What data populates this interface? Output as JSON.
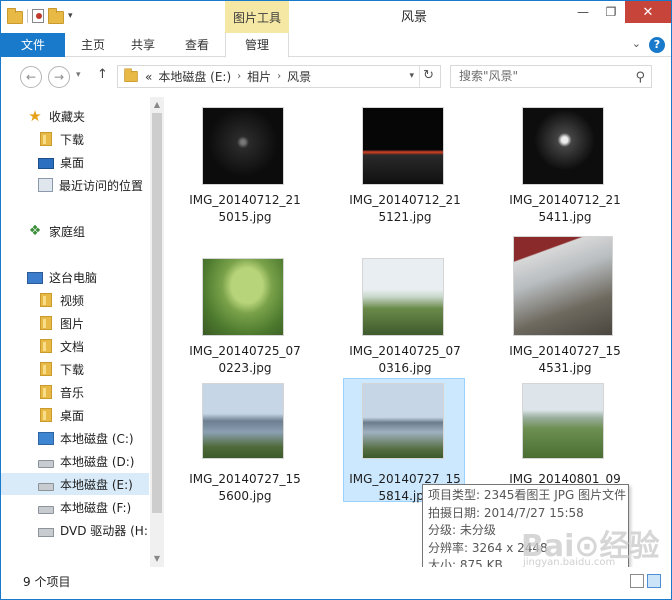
{
  "window": {
    "title": "风景",
    "context_tab_header": "图片工具"
  },
  "ribbon": {
    "tabs": [
      {
        "label": "文件"
      },
      {
        "label": "主页"
      },
      {
        "label": "共享"
      },
      {
        "label": "查看"
      },
      {
        "label": "管理"
      }
    ]
  },
  "address": {
    "prefix": "«",
    "crumbs": [
      "本地磁盘 (E:)",
      "相片",
      "风景"
    ]
  },
  "search": {
    "placeholder": "搜索\"风景\""
  },
  "sidebar": {
    "items": [
      {
        "label": "收藏夹",
        "icon": "star-icon"
      },
      {
        "label": "下载",
        "icon": "downloads-folder-icon"
      },
      {
        "label": "桌面",
        "icon": "desktop-icon"
      },
      {
        "label": "最近访问的位置",
        "icon": "recent-places-icon"
      },
      {
        "label": "家庭组",
        "icon": "homegroup-icon"
      },
      {
        "label": "这台电脑",
        "icon": "computer-icon"
      },
      {
        "label": "视频",
        "icon": "videos-folder-icon"
      },
      {
        "label": "图片",
        "icon": "pictures-folder-icon"
      },
      {
        "label": "文档",
        "icon": "documents-folder-icon"
      },
      {
        "label": "下载",
        "icon": "downloads-folder-icon"
      },
      {
        "label": "音乐",
        "icon": "music-folder-icon"
      },
      {
        "label": "桌面",
        "icon": "desktop-folder-icon"
      },
      {
        "label": "本地磁盘 (C:)",
        "icon": "system-drive-icon"
      },
      {
        "label": "本地磁盘 (D:)",
        "icon": "drive-icon"
      },
      {
        "label": "本地磁盘 (E:)",
        "icon": "drive-icon"
      },
      {
        "label": "本地磁盘 (F:)",
        "icon": "drive-icon"
      },
      {
        "label": "DVD 驱动器 (H:)",
        "icon": "dvd-drive-icon"
      }
    ]
  },
  "files": [
    {
      "name": "IMG_20140712_215015.jpg"
    },
    {
      "name": "IMG_20140712_215121.jpg"
    },
    {
      "name": "IMG_20140712_215411.jpg"
    },
    {
      "name": "IMG_20140725_070223.jpg"
    },
    {
      "name": "IMG_20140725_070316.jpg"
    },
    {
      "name": "IMG_20140727_154531.jpg"
    },
    {
      "name": "IMG_20140727_155600.jpg"
    },
    {
      "name": "IMG_20140727_155814.jpg"
    },
    {
      "name": "IMG_20140801_09"
    }
  ],
  "tooltip": {
    "type": "项目类型: 2345看图王 JPG 图片文件",
    "date": "拍摄日期: 2014/7/27 15:58",
    "rating": "分级: 未分级",
    "resolution": "分辨率: 3264 x 2448",
    "size": "大小: 875 KB"
  },
  "status": {
    "count": "9 个项目"
  },
  "watermark": {
    "brand": "Bai⊙经验",
    "url": "jingyan.baidu.com"
  }
}
